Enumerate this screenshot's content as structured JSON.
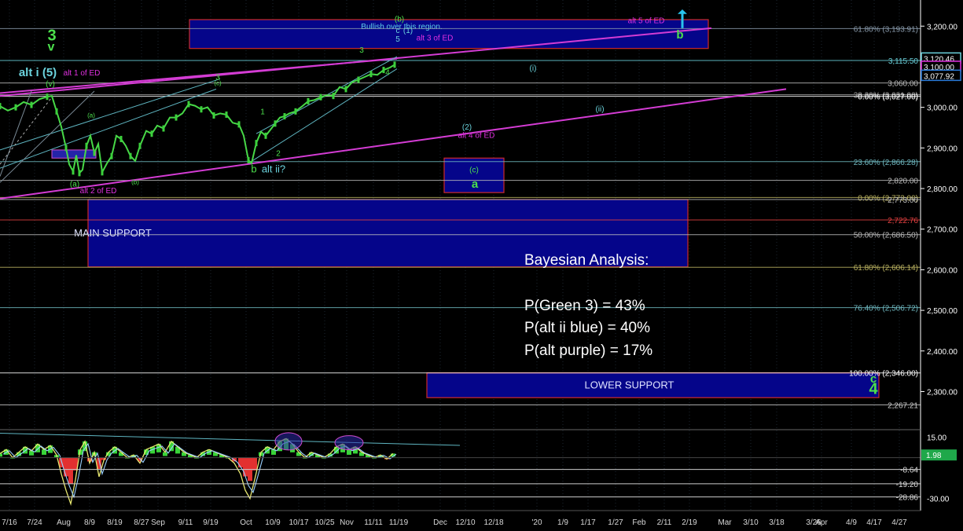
{
  "chart_data": {
    "type": "line",
    "title": "",
    "price_axis": {
      "ylim": [
        2210,
        3245
      ],
      "ticks": [
        3200,
        3100,
        3000,
        2900,
        2800,
        2700,
        2600,
        2500,
        2400,
        2300
      ],
      "tick_labels": [
        "3,200.00",
        "3,100.00",
        "3,000.00",
        "2,900.00",
        "2,800.00",
        "2,700.00",
        "2,600.00",
        "2,500.00",
        "2,400.00",
        "2,300.00"
      ]
    },
    "indicator_axis": {
      "ylim": [
        -36,
        20
      ],
      "ticks": [
        15,
        -30
      ],
      "tick_labels": [
        "15.00",
        "-30.00"
      ],
      "levels": [
        {
          "value": -8.64,
          "label": "-8.64"
        },
        {
          "value": -19.2,
          "label": "-19.20"
        },
        {
          "value": -28.86,
          "label": "-28.86"
        }
      ],
      "current": {
        "value": 1.98,
        "label": "1.98"
      }
    },
    "x_axis": {
      "labels": [
        "7/16",
        "7/24",
        "Aug",
        "8/9",
        "8/19",
        "8/27",
        "Sep",
        "9/11",
        "9/19",
        "Oct",
        "10/9",
        "10/17",
        "10/25",
        "Nov",
        "11/11",
        "11/19",
        "Dec",
        "12/10",
        "12/18",
        "'20",
        "1/9",
        "1/17",
        "1/27",
        "Feb",
        "2/11",
        "2/19",
        "Mar",
        "3/10",
        "3/18",
        "3/26",
        "Apr",
        "4/9",
        "4/17",
        "4/27"
      ],
      "positions": [
        12,
        44,
        81,
        114,
        146,
        180,
        201,
        236,
        268,
        313,
        347,
        380,
        413,
        441,
        475,
        507,
        560,
        592,
        628,
        683,
        716,
        748,
        783,
        813,
        845,
        877,
        922,
        955,
        988,
        1035,
        1045,
        1083,
        1112,
        1144
      ]
    },
    "price_series": [
      [
        0,
        3003
      ],
      [
        10,
        2992
      ],
      [
        20,
        3000
      ],
      [
        30,
        3013
      ],
      [
        40,
        3006
      ],
      [
        50,
        3020
      ],
      [
        60,
        3026
      ],
      [
        66,
        3028
      ],
      [
        72,
        2990
      ],
      [
        78,
        2952
      ],
      [
        84,
        2900
      ],
      [
        88,
        2860
      ],
      [
        93,
        2842
      ],
      [
        97,
        2882
      ],
      [
        101,
        2838
      ],
      [
        105,
        2846
      ],
      [
        110,
        2905
      ],
      [
        115,
        2930
      ],
      [
        120,
        2888
      ],
      [
        125,
        2910
      ],
      [
        130,
        2840
      ],
      [
        136,
        2862
      ],
      [
        142,
        2880
      ],
      [
        148,
        2930
      ],
      [
        154,
        2922
      ],
      [
        160,
        2905
      ],
      [
        166,
        2880
      ],
      [
        172,
        2868
      ],
      [
        178,
        2905
      ],
      [
        186,
        2942
      ],
      [
        193,
        2935
      ],
      [
        200,
        2955
      ],
      [
        208,
        2948
      ],
      [
        216,
        2975
      ],
      [
        224,
        2975
      ],
      [
        232,
        2985
      ],
      [
        240,
        3008
      ],
      [
        248,
        3004
      ],
      [
        256,
        2995
      ],
      [
        264,
        3000
      ],
      [
        272,
        2980
      ],
      [
        280,
        2985
      ],
      [
        288,
        2982
      ],
      [
        296,
        2962
      ],
      [
        304,
        2958
      ],
      [
        310,
        2930
      ],
      [
        316,
        2870
      ],
      [
        320,
        2862
      ],
      [
        326,
        2912
      ],
      [
        332,
        2940
      ],
      [
        338,
        2930
      ],
      [
        344,
        2945
      ],
      [
        350,
        2960
      ],
      [
        356,
        2975
      ],
      [
        362,
        2978
      ],
      [
        368,
        2985
      ],
      [
        376,
        2990
      ],
      [
        384,
        3002
      ],
      [
        392,
        3015
      ],
      [
        400,
        3018
      ],
      [
        408,
        3025
      ],
      [
        416,
        3030
      ],
      [
        424,
        3028
      ],
      [
        432,
        3050
      ],
      [
        440,
        3045
      ],
      [
        448,
        3062
      ],
      [
        456,
        3068
      ],
      [
        464,
        3075
      ],
      [
        472,
        3082
      ],
      [
        480,
        3080
      ],
      [
        488,
        3092
      ],
      [
        496,
        3098
      ],
      [
        502,
        3105
      ]
    ],
    "indicator_series": [
      [
        0,
        3
      ],
      [
        8,
        6
      ],
      [
        16,
        0
      ],
      [
        24,
        4
      ],
      [
        32,
        8
      ],
      [
        40,
        5
      ],
      [
        48,
        10
      ],
      [
        56,
        6
      ],
      [
        64,
        9
      ],
      [
        72,
        2
      ],
      [
        78,
        -12
      ],
      [
        84,
        -24
      ],
      [
        90,
        -34
      ],
      [
        96,
        -16
      ],
      [
        102,
        6
      ],
      [
        108,
        12
      ],
      [
        114,
        -4
      ],
      [
        120,
        4
      ],
      [
        126,
        -14
      ],
      [
        132,
        -2
      ],
      [
        138,
        4
      ],
      [
        146,
        8
      ],
      [
        154,
        4
      ],
      [
        162,
        0
      ],
      [
        170,
        2
      ],
      [
        178,
        -4
      ],
      [
        186,
        6
      ],
      [
        194,
        8
      ],
      [
        202,
        10
      ],
      [
        210,
        4
      ],
      [
        218,
        12
      ],
      [
        226,
        8
      ],
      [
        234,
        4
      ],
      [
        242,
        2
      ],
      [
        250,
        0
      ],
      [
        258,
        4
      ],
      [
        266,
        6
      ],
      [
        274,
        4
      ],
      [
        282,
        2
      ],
      [
        290,
        0
      ],
      [
        298,
        -4
      ],
      [
        306,
        -12
      ],
      [
        312,
        -24
      ],
      [
        318,
        -30
      ],
      [
        324,
        -16
      ],
      [
        332,
        4
      ],
      [
        340,
        8
      ],
      [
        348,
        6
      ],
      [
        356,
        12
      ],
      [
        364,
        14
      ],
      [
        372,
        10
      ],
      [
        380,
        4
      ],
      [
        388,
        0
      ],
      [
        396,
        4
      ],
      [
        404,
        2
      ],
      [
        412,
        0
      ],
      [
        420,
        3
      ],
      [
        428,
        8
      ],
      [
        436,
        10
      ],
      [
        444,
        6
      ],
      [
        452,
        8
      ],
      [
        460,
        4
      ],
      [
        468,
        2
      ],
      [
        476,
        0
      ],
      [
        484,
        2
      ],
      [
        492,
        -1
      ],
      [
        500,
        3
      ]
    ],
    "horizontal_levels": [
      {
        "value": 3193.91,
        "label": "61.80% (3,193.91)",
        "color": "#8899aa"
      },
      {
        "value": 3115.5,
        "label": "3,115.50",
        "color": "#6bd3dd"
      },
      {
        "value": 3060,
        "label": "3,060.00",
        "color": "#bbbbbb"
      },
      {
        "value": 3031,
        "label": "38.20% (3,031.00)",
        "color": "#aaaaaa"
      },
      {
        "value": 3027,
        "label": "0.00% (3,027.00)",
        "color": "#ffffff"
      },
      {
        "value": 2866.28,
        "label": "23.60% (2,866.28)",
        "color": "#6fb8c0"
      },
      {
        "value": 2820,
        "label": "2,820.00",
        "color": "#bbbbbb"
      },
      {
        "value": 2778,
        "label": "0.00% (2,773.00)",
        "color": "#b8b060"
      },
      {
        "value": 2773,
        "label": "2,773.00",
        "color": "#bbbbbb"
      },
      {
        "value": 2722.76,
        "label": "2,722.76",
        "color": "#e34040"
      },
      {
        "value": 2686.5,
        "label": "50.00% (2,686.50)",
        "color": "#bbbbbb"
      },
      {
        "value": 2606.14,
        "label": "61.80% (2,606.14)",
        "color": "#b8b060"
      },
      {
        "value": 2506.72,
        "label": "76.40% (2,506.72)",
        "color": "#6fb8c0"
      },
      {
        "value": 2346,
        "label": "100.00% (2,346.00)",
        "color": "#ffffff"
      },
      {
        "value": 2267.21,
        "label": "2,267.21",
        "color": "#cccccc"
      }
    ],
    "price_badges": [
      {
        "value": 3120.46,
        "label": "3,120.46",
        "color": "#6bd3dd"
      },
      {
        "value": 3100,
        "label": "3,100.00",
        "color": "#e030e0"
      },
      {
        "value": 3077.92,
        "label": "3,077.92",
        "color": "#2a7ad8"
      }
    ],
    "zones": [
      {
        "label": "Bullish over this region.",
        "y1": 3145,
        "y2": 3216
      },
      {
        "label": "",
        "y1": 2790,
        "y2": 2875
      },
      {
        "label": "MAIN SUPPORT",
        "y1": 2607,
        "y2": 2773
      },
      {
        "label": "LOWER SUPPORT",
        "y1": 2285,
        "y2": 2346
      }
    ],
    "wave_labels": [
      {
        "text": "3",
        "x": 66,
        "y": 3165,
        "color": "#4ce04c",
        "size": 20
      },
      {
        "text": "v",
        "x": 65,
        "y": 3140,
        "color": "#4ce04c",
        "size": 16
      },
      {
        "text": "alt i (5)",
        "x": 48,
        "y": 3077,
        "color": "#6bd3dd",
        "size": 15
      },
      {
        "text": "alt 1 of ED",
        "x": 104,
        "y": 3079,
        "color": "#e030e0",
        "size": 10
      },
      {
        "text": "(v)",
        "x": 64,
        "y": 3052,
        "color": "#4ce04c",
        "size": 10
      },
      {
        "text": "(b)",
        "x": 508,
        "y": 3211,
        "color": "#4ce04c",
        "size": 10
      },
      {
        "text": "c",
        "x": 506,
        "y": 3183,
        "color": "#6bd3dd",
        "size": 10
      },
      {
        "text": "(1)",
        "x": 519,
        "y": 3183,
        "color": "#6bd3dd",
        "size": 10
      },
      {
        "text": "5",
        "x": 506,
        "y": 3162,
        "color": "#6bd3dd",
        "size": 10
      },
      {
        "text": "alt 3 of ED",
        "x": 553,
        "y": 3165,
        "color": "#e030e0",
        "size": 10
      },
      {
        "text": "alt 5 of ED",
        "x": 822,
        "y": 3207,
        "color": "#e030e0",
        "size": 10
      },
      {
        "text": "b",
        "x": 865,
        "y": 3170,
        "color": "#4ce04c",
        "size": 15
      },
      {
        "text": "(i)",
        "x": 678,
        "y": 3090,
        "color": "#6bd3dd",
        "size": 10
      },
      {
        "text": "(ii)",
        "x": 763,
        "y": 2990,
        "color": "#6bd3dd",
        "size": 10
      },
      {
        "text": "(2)",
        "x": 594,
        "y": 2945,
        "color": "#6bd3dd",
        "size": 10
      },
      {
        "text": "alt 4 of ED",
        "x": 606,
        "y": 2925,
        "color": "#e030e0",
        "size": 10
      },
      {
        "text": "(c)",
        "x": 603,
        "y": 2840,
        "color": "#4ce04c",
        "size": 10
      },
      {
        "text": "a",
        "x": 604,
        "y": 2802,
        "color": "#4ce04c",
        "size": 15
      },
      {
        "text": "b",
        "x": 323,
        "y": 2840,
        "color": "#4ce04c",
        "size": 13
      },
      {
        "text": "alt ii?",
        "x": 348,
        "y": 2840,
        "color": "#6bd3dd",
        "size": 13
      },
      {
        "text": "1",
        "x": 334,
        "y": 2983,
        "color": "#4ce04c",
        "size": 10
      },
      {
        "text": "2",
        "x": 354,
        "y": 2880,
        "color": "#4ce04c",
        "size": 10
      },
      {
        "text": "3",
        "x": 460,
        "y": 3135,
        "color": "#4ce04c",
        "size": 10
      },
      {
        "text": "4",
        "x": 493,
        "y": 3080,
        "color": "#4ce04c",
        "size": 10
      },
      {
        "text": "3",
        "x": 277,
        "y": 3068,
        "color": "#4ce04c",
        "size": 10
      },
      {
        "text": "(a)",
        "x": 95,
        "y": 2805,
        "color": "#4ce04c",
        "size": 10
      },
      {
        "text": "alt 2 of ED",
        "x": 125,
        "y": 2788,
        "color": "#e030e0",
        "size": 10
      },
      {
        "text": "(a)",
        "x": 116,
        "y": 2975,
        "color": "#4ce04c",
        "size": 8
      },
      {
        "text": "(b)",
        "x": 172,
        "y": 2811,
        "color": "#4ce04c",
        "size": 8
      },
      {
        "text": "(c)",
        "x": 277,
        "y": 3054,
        "color": "#4ce04c",
        "size": 8
      },
      {
        "text": "c",
        "x": 1111,
        "y": 2322,
        "color": "#4ce04c",
        "size": 15
      },
      {
        "text": "4",
        "x": 1111,
        "y": 2294,
        "color": "#4ce04c",
        "size": 20
      }
    ],
    "arrow": {
      "x": 868,
      "color": "#29c4ec"
    }
  },
  "overlay": {
    "title": "Bayesian Analysis:",
    "lines": [
      "P(Green 3) = 43%",
      "P(alt ii blue) = 40%",
      "P(alt purple) =  17%"
    ]
  }
}
